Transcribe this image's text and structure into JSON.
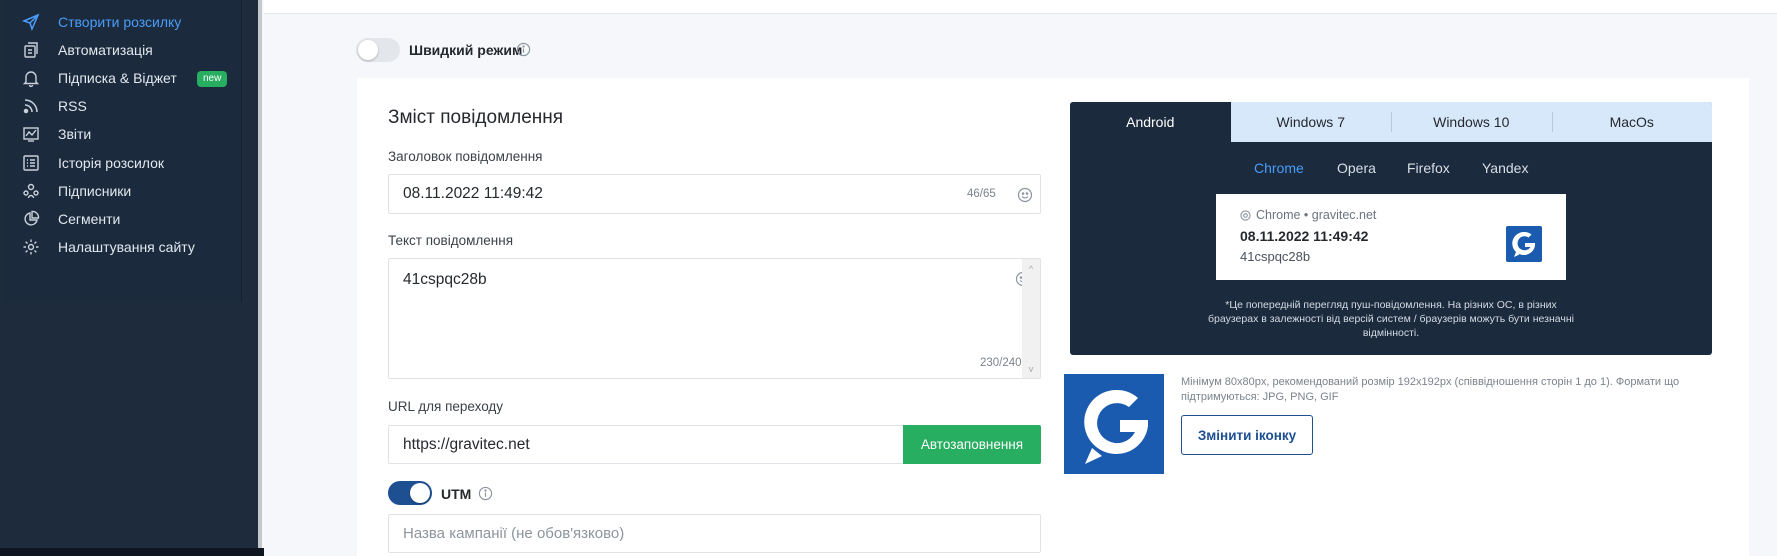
{
  "sidebar": {
    "items": [
      {
        "label": "Створити розсилку",
        "icon": "send-icon",
        "active": true
      },
      {
        "label": "Автоматизація",
        "icon": "automation-icon"
      },
      {
        "label": "Підписка & Віджет",
        "icon": "bell-icon",
        "badge": "new"
      },
      {
        "label": "RSS",
        "icon": "rss-icon"
      },
      {
        "label": "Звіти",
        "icon": "reports-icon"
      },
      {
        "label": "Історія розсилок",
        "icon": "history-icon"
      },
      {
        "label": "Підписники",
        "icon": "subscribers-icon"
      },
      {
        "label": "Сегменти",
        "icon": "segments-icon"
      },
      {
        "label": "Налаштування сайту",
        "icon": "settings-icon"
      }
    ]
  },
  "fast_mode": {
    "label": "Швидкий режим",
    "enabled": false
  },
  "form": {
    "section_title": "Зміст повідомлення",
    "title_label": "Заголовок повідомлення",
    "title_value": "08.11.2022 11:49:42",
    "title_counter": "46/65",
    "text_label": "Текст повідомлення",
    "text_value": "41cspqc28b",
    "text_counter": "230/240",
    "url_label": "URL для переходу",
    "url_value": "https://gravitec.net",
    "autofill_label": "Автозаповнення",
    "utm_label": "UTM",
    "utm_enabled": true,
    "campaign_placeholder": "Назва кампанії (не обов'язково)"
  },
  "preview": {
    "os_tabs": [
      "Android",
      "Windows 7",
      "Windows 10",
      "MacOs"
    ],
    "active_os": "Android",
    "browser_tabs": [
      "Chrome",
      "Opera",
      "Firefox",
      "Yandex"
    ],
    "active_browser": "Chrome",
    "notification": {
      "source": "Chrome • gravitec.net",
      "title": "08.11.2022 11:49:42",
      "body": "41cspqc28b"
    },
    "note": "*Це попередній перегляд пуш-повідомлення. На різних ОС, в різних браузерах в залежності від версій систем / браузерів можуть бути незначні відмінності."
  },
  "icon_block": {
    "hint": "Мінімум 80x80px, рекомендований розмір 192x192px (співвідношення сторін 1 до 1). Формати що підтримуються: JPG, PNG, GIF",
    "change_label": "Змінити іконку"
  },
  "colors": {
    "sidebar_bg": "#1b2a3d",
    "accent_blue": "#4a9df8",
    "brand_navy": "#1d4f91",
    "green": "#27ae60",
    "tab_light": "#d7e8fb",
    "logo_blue": "#1a5bb0"
  }
}
